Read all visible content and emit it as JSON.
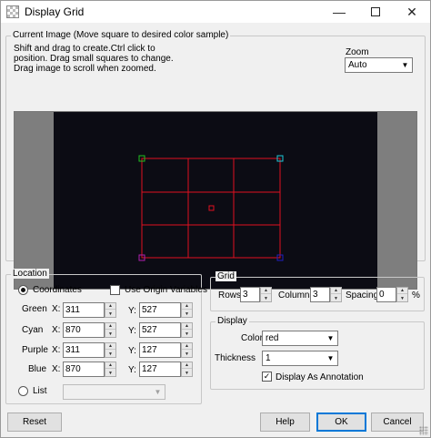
{
  "window": {
    "title": "Display Grid",
    "icons": {
      "app": "grid-app-icon",
      "minimize": "minimize-icon",
      "maximize": "maximize-icon",
      "close": "close-icon"
    }
  },
  "current_image": {
    "label": "Current Image (Move square to desired color sample)",
    "help": [
      "Shift and drag to create.Ctrl click to",
      "position. Drag small squares to change.",
      "Drag image to scroll when zoomed."
    ],
    "zoom_label": "Zoom",
    "zoom_value": "Auto"
  },
  "colors": {
    "grid": "#e01020",
    "green": "#20c020",
    "cyan": "#20c8d8",
    "purple": "#b020b0",
    "blue": "#2020c0",
    "center": "#e01020"
  },
  "location": {
    "label": "Location",
    "coordinates_label": "Coordinates",
    "coordinates_selected": true,
    "origin_label": "Use Origin Variables",
    "origin_checked": false,
    "rows": [
      {
        "name": "Green",
        "x": "311",
        "y": "527"
      },
      {
        "name": "Cyan",
        "x": "870",
        "y": "527"
      },
      {
        "name": "Purple",
        "x": "311",
        "y": "127"
      },
      {
        "name": "Blue",
        "x": "870",
        "y": "127"
      }
    ],
    "x_label": "X:",
    "y_label": "Y:",
    "list_label": "List",
    "list_value": ""
  },
  "grid": {
    "label": "Grid",
    "rows_label": "Rows",
    "rows_value": "3",
    "columns_label": "Columns",
    "columns_value": "3",
    "spacing_label": "Spacing",
    "spacing_value": "0",
    "spacing_unit": "%"
  },
  "display": {
    "label": "Display",
    "color_label": "Color",
    "color_value": "red",
    "thickness_label": "Thickness",
    "thickness_value": "1",
    "annotation_label": "Display As Annotation",
    "annotation_checked": true
  },
  "buttons": {
    "reset": "Reset",
    "help": "Help",
    "ok": "OK",
    "cancel": "Cancel"
  }
}
